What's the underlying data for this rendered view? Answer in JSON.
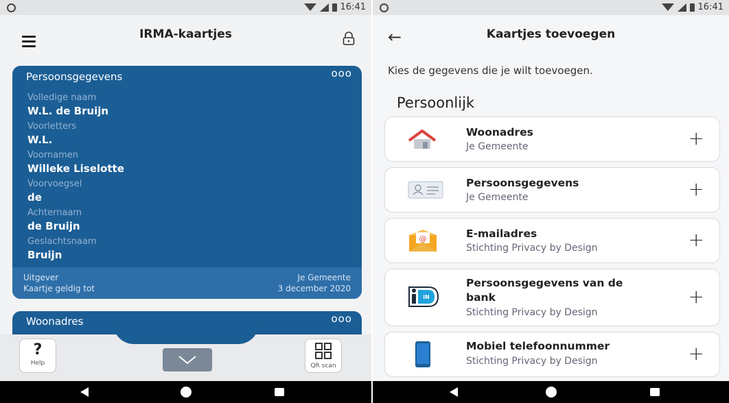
{
  "left": {
    "status_time": "16:41",
    "app_title": "IRMA-kaartjes",
    "card": {
      "title": "Persoonsgegevens",
      "menu": "ooo",
      "fields": [
        {
          "label": "Volledige naam",
          "value": "W.L. de Bruijn"
        },
        {
          "label": "Voorletters",
          "value": "W.L."
        },
        {
          "label": "Voornamen",
          "value": "Willeke Liselotte"
        },
        {
          "label": "Voorvoegsel",
          "value": "de"
        },
        {
          "label": "Achternaam",
          "value": "de Bruijn"
        },
        {
          "label": "Geslachtsnaam",
          "value": "Bruijn"
        }
      ],
      "footer": {
        "issuer_label": "Uitgever",
        "issuer_value": "Je Gemeente",
        "valid_label": "Kaartje geldig tot",
        "valid_value": "3 december 2020"
      }
    },
    "second_card": {
      "title": "Woonadres",
      "menu": "ooo"
    },
    "help_glyph": "?",
    "help_label": "Help",
    "qr_label": "QR scan"
  },
  "right": {
    "status_time": "16:41",
    "app_title": "Kaartjes toevoegen",
    "intro": "Kies de gegevens die je wilt toevoegen.",
    "section_title": "Persoonlijk",
    "items": [
      {
        "title": "Woonadres",
        "issuer": "Je Gemeente",
        "icon": "house-icon"
      },
      {
        "title": "Persoonsgegevens",
        "issuer": "Je Gemeente",
        "icon": "id-card-icon"
      },
      {
        "title": "E-mailadres",
        "issuer": "Stichting Privacy by Design",
        "icon": "email-icon"
      },
      {
        "title_line1": "Persoonsgegevens van de",
        "title_line2": "bank",
        "issuer": "Stichting Privacy by Design",
        "icon": "ideal-icon"
      },
      {
        "title": "Mobiel telefoonnummer",
        "issuer": "Stichting Privacy by Design",
        "icon": "phone-icon"
      }
    ],
    "plus": "+"
  },
  "colors": {
    "card_blue": "#1b5e95",
    "footer_blue": "#2e6fa9",
    "email_orange": "#f5a623",
    "house_red": "#d9443b"
  }
}
